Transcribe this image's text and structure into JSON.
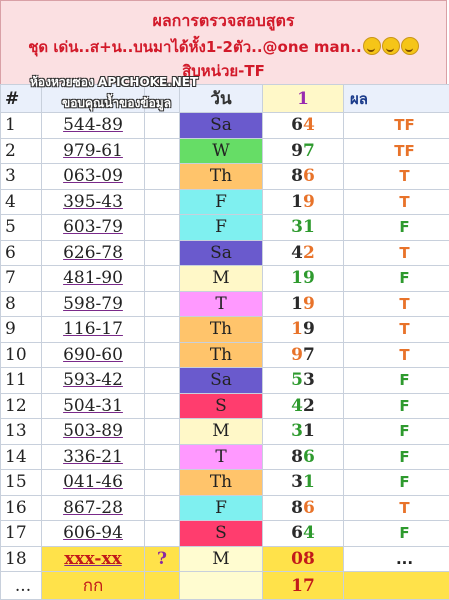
{
  "header": {
    "line1": "ผลการตรวจสอบสูตร",
    "line2": "ชุด เด่น..ส+น..บนมาได้หั้ง1-2ตัว..@one man..",
    "emoji_count": 3,
    "line3": "สิบหน่วย-TF"
  },
  "watermark": {
    "line1": "ห้องหวยซอง APICHOKE.NET",
    "line2": "ขอบคุณน้ำของข้อมูล"
  },
  "columns": {
    "num": "#",
    "day": "วัน",
    "digit": "1",
    "result": "ผล"
  },
  "colors": {
    "Sa": "#6a5acd",
    "W": "#66dd66",
    "Th": "#ffc46b",
    "F": "#7ff0f0",
    "M": "#fff8c8",
    "T": "#ff99ff",
    "S": "#ff3d6e",
    "result_T": "#e8732a",
    "result_F": "#2e9a2e",
    "digit_green": "#2e9a2e",
    "digit_orange": "#e8732a"
  },
  "rows": [
    {
      "n": "1",
      "num": "544-89",
      "day": "Sa",
      "d1": "6",
      "d2": "4",
      "d2c": "orange",
      "res": "TF",
      "resc": "orange"
    },
    {
      "n": "2",
      "num": "979-61",
      "day": "W",
      "d1": "9",
      "d2": "7",
      "d2c": "green",
      "res": "TF",
      "resc": "orange"
    },
    {
      "n": "3",
      "num": "063-09",
      "day": "Th",
      "d1": "8",
      "d2": "6",
      "d2c": "orange",
      "res": "T",
      "resc": "orange"
    },
    {
      "n": "4",
      "num": "395-43",
      "day": "F",
      "d1": "1",
      "d2": "9",
      "d2c": "orange",
      "res": "T",
      "resc": "orange"
    },
    {
      "n": "5",
      "num": "603-79",
      "day": "F",
      "d1": "3",
      "d2": "1",
      "d2c": "green",
      "res": "F",
      "resc": "green",
      "d1c": "green"
    },
    {
      "n": "6",
      "num": "626-78",
      "day": "Sa",
      "d1": "4",
      "d2": "2",
      "d2c": "orange",
      "res": "T",
      "resc": "orange"
    },
    {
      "n": "7",
      "num": "481-90",
      "day": "M",
      "d1": "1",
      "d2": "9",
      "d2c": "green",
      "res": "F",
      "resc": "green",
      "d1c": "green"
    },
    {
      "n": "8",
      "num": "598-79",
      "day": "T",
      "d1": "1",
      "d2": "9",
      "d2c": "orange",
      "res": "T",
      "resc": "orange"
    },
    {
      "n": "9",
      "num": "116-17",
      "day": "Th",
      "d1": "1",
      "d2": "9",
      "d2c": "dark",
      "res": "T",
      "resc": "orange",
      "d1c": "orange"
    },
    {
      "n": "10",
      "num": "690-60",
      "day": "Th",
      "d1": "9",
      "d2": "7",
      "d2c": "dark",
      "res": "T",
      "resc": "orange",
      "d1c": "orange"
    },
    {
      "n": "11",
      "num": "593-42",
      "day": "Sa",
      "d1": "5",
      "d2": "3",
      "d2c": "dark",
      "res": "F",
      "resc": "green",
      "d1c": "green"
    },
    {
      "n": "12",
      "num": "504-31",
      "day": "S",
      "d1": "4",
      "d2": "2",
      "d2c": "dark",
      "res": "F",
      "resc": "green",
      "d1c": "green"
    },
    {
      "n": "13",
      "num": "503-89",
      "day": "M",
      "d1": "3",
      "d2": "1",
      "d2c": "dark",
      "res": "F",
      "resc": "green",
      "d1c": "green"
    },
    {
      "n": "14",
      "num": "336-21",
      "day": "T",
      "d1": "8",
      "d2": "6",
      "d2c": "green",
      "res": "F",
      "resc": "green"
    },
    {
      "n": "15",
      "num": "041-46",
      "day": "Th",
      "d1": "3",
      "d2": "1",
      "d2c": "green",
      "res": "F",
      "resc": "green"
    },
    {
      "n": "16",
      "num": "867-28",
      "day": "F",
      "d1": "8",
      "d2": "6",
      "d2c": "orange",
      "res": "T",
      "resc": "orange"
    },
    {
      "n": "17",
      "num": "606-94",
      "day": "S",
      "d1": "6",
      "d2": "4",
      "d2c": "green",
      "res": "F",
      "resc": "green"
    }
  ],
  "last_row": {
    "n": "18",
    "num": "xxx-xx",
    "q": "?",
    "day": "M",
    "digit": "08",
    "res": "..."
  },
  "foot_row": {
    "n": "...",
    "num": "กก",
    "digit": "17"
  }
}
